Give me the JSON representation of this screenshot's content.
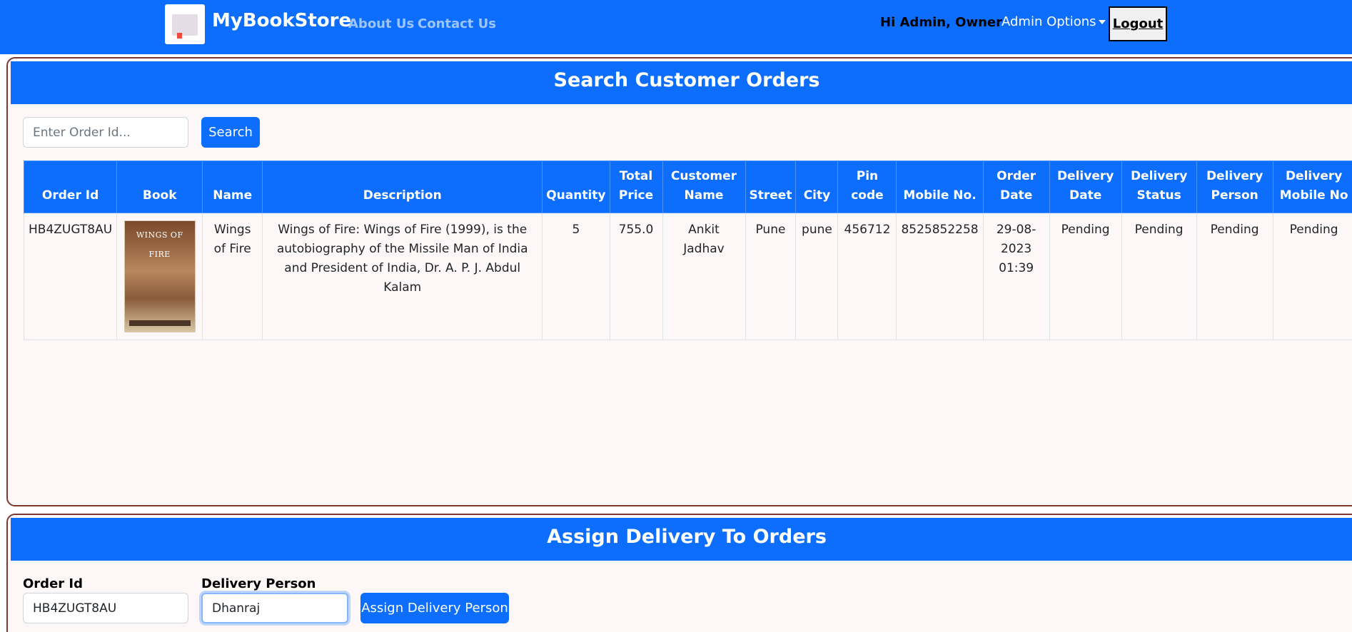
{
  "navbar": {
    "brand": "MyBookStore",
    "links": [
      "About Us",
      "Contact Us"
    ],
    "greeting": "Hi Admin, Owner",
    "admin_options": "Admin Options",
    "logout": "Logout",
    "bg_color": "#0d6efd"
  },
  "search_section": {
    "title": "Search Customer Orders",
    "order_input_placeholder": "Enter Order Id...",
    "search_label": "Search",
    "columns": [
      "Order Id",
      "Book",
      "Name",
      "Description",
      "Quantity",
      "Total Price",
      "Customer Name",
      "Street",
      "City",
      "Pin code",
      "Mobile No.",
      "Order Date",
      "Delivery Date",
      "Delivery Status",
      "Delivery Person",
      "Delivery Mobile No"
    ],
    "rows": [
      {
        "order_id": "HB4ZUGT8AU",
        "book_cover_text": "WINGS OF FIRE",
        "name": "Wings of Fire",
        "description": "Wings of Fire: Wings of Fire (1999), is the autobiography of the Missile Man of India and President of India, Dr. A. P. J. Abdul Kalam",
        "quantity": "5",
        "total_price": "755.0",
        "customer_name": "Ankit Jadhav",
        "street": "Pune",
        "city": "pune",
        "pin_code": "456712",
        "mobile": "8525852258",
        "order_date": "29-08-2023 01:39",
        "delivery_date": "Pending",
        "delivery_status": "Pending",
        "delivery_person": "Pending",
        "delivery_mobile": "Pending"
      }
    ]
  },
  "assign_section": {
    "title": "Assign Delivery To Orders",
    "order_id_label": "Order Id",
    "order_id_value": "HB4ZUGT8AU",
    "delivery_person_label": "Delivery Person",
    "delivery_person_value": "Dhanraj",
    "assign_label": "Assign Delivery Person"
  }
}
